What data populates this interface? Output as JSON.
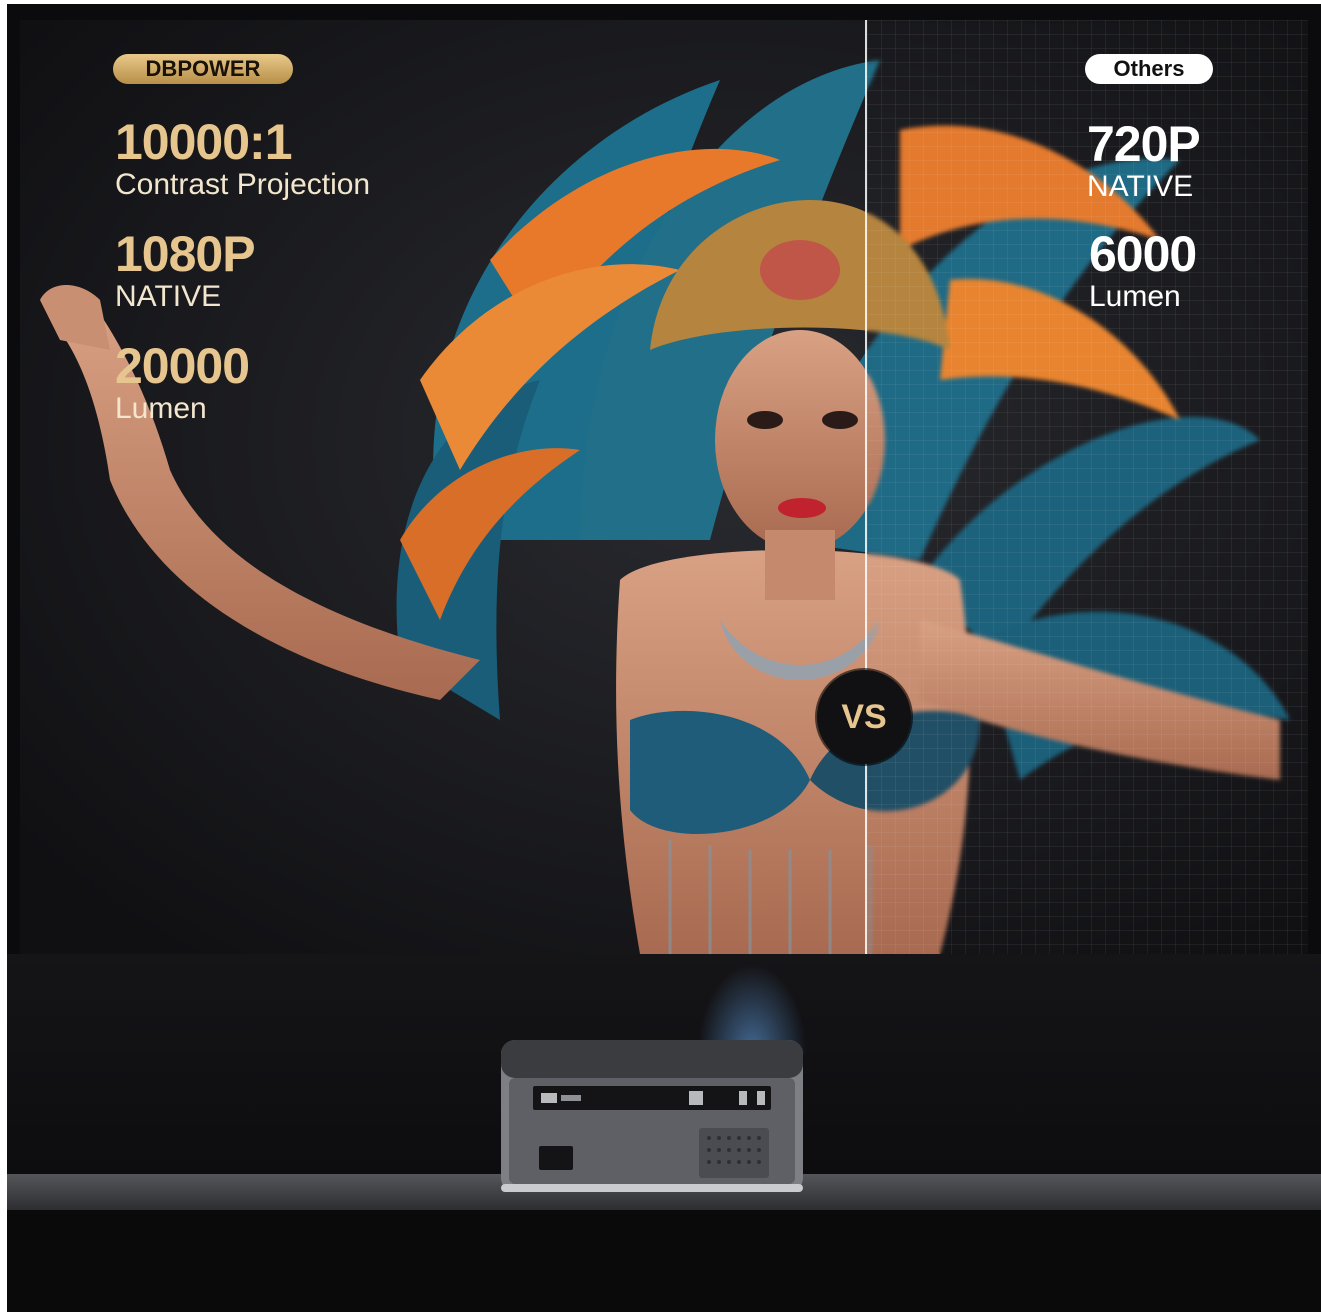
{
  "brand_badge": "DBPOWER",
  "competitor_badge": "Others",
  "left_specs": [
    {
      "value": "10000:1",
      "label": "Contrast Projection"
    },
    {
      "value": "1080P",
      "label": "NATIVE"
    },
    {
      "value": "20000",
      "label": "Lumen"
    }
  ],
  "right_specs": [
    {
      "value": "720P",
      "label": "NATIVE"
    },
    {
      "value": "6000",
      "label": "Lumen"
    }
  ],
  "vs_label": "VS",
  "colors": {
    "gold": "#e6c68e",
    "teal": "#1e6f8a",
    "orange": "#e8792b",
    "background": "#0b0b0e"
  }
}
